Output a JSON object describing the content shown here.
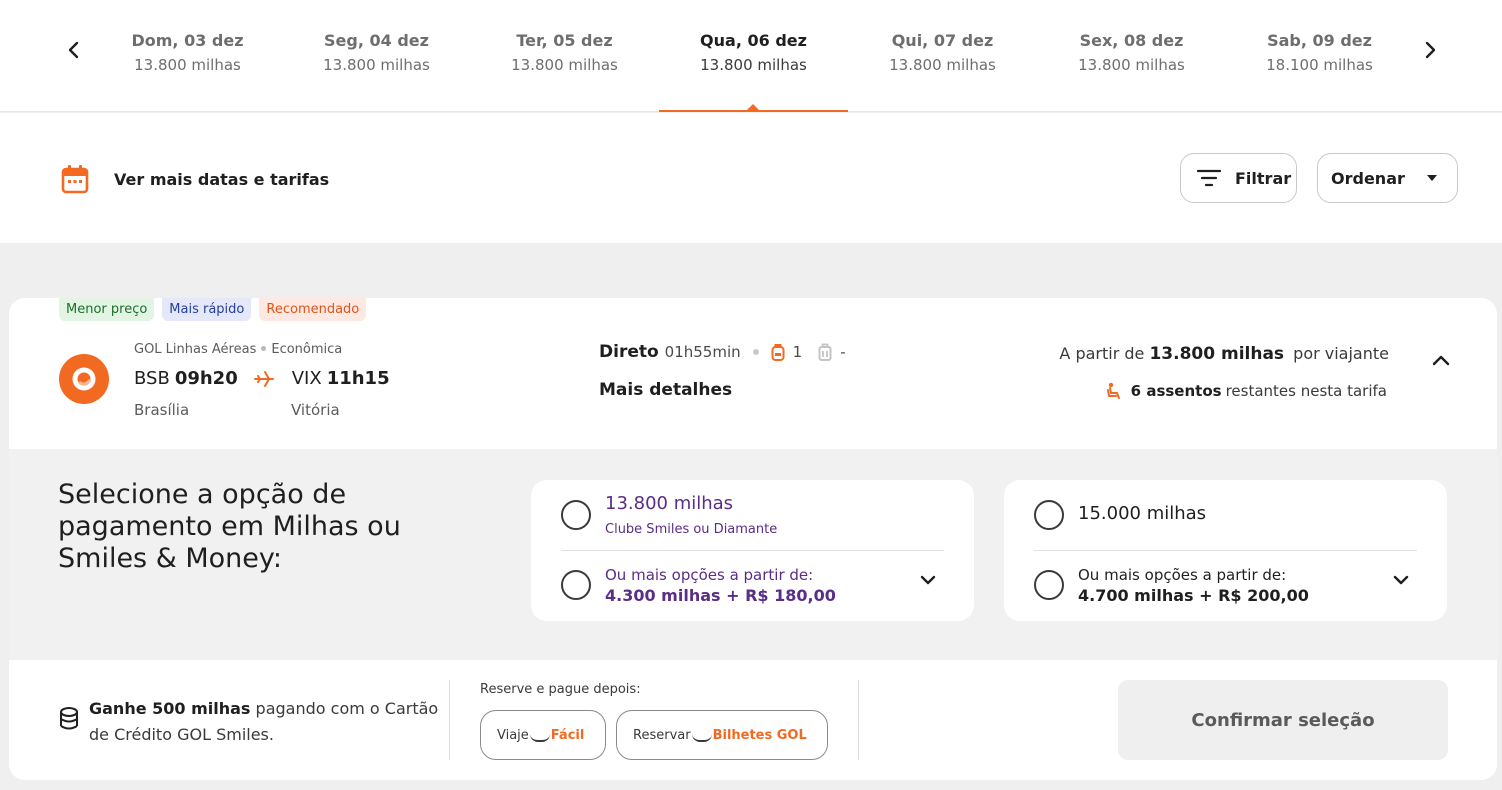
{
  "dates": [
    {
      "day": "Dom, 03 dez",
      "price": "13.800 milhas",
      "active": false
    },
    {
      "day": "Seg, 04 dez",
      "price": "13.800 milhas",
      "active": false
    },
    {
      "day": "Ter, 05 dez",
      "price": "13.800 milhas",
      "active": false
    },
    {
      "day": "Qua, 06 dez",
      "price": "13.800 milhas",
      "active": true
    },
    {
      "day": "Qui, 07 dez",
      "price": "13.800 milhas",
      "active": false
    },
    {
      "day": "Sex, 08 dez",
      "price": "13.800 milhas",
      "active": false
    },
    {
      "day": "Sab, 09 dez",
      "price": "18.100 milhas",
      "active": false
    }
  ],
  "toolbar": {
    "more_dates_label": "Ver mais datas e tarifas",
    "filter_label": "Filtrar",
    "order_label": "Ordenar"
  },
  "colors": {
    "accent": "#f26a21",
    "purple": "#5a2d86"
  },
  "flight": {
    "badges": [
      "Menor preço",
      "Mais rápido",
      "Recomendado"
    ],
    "airline": "GOL Linhas Aéreas",
    "cabin": "Econômica",
    "origin_code": "BSB",
    "departure": "09h20",
    "origin_city": "Brasília",
    "dest_code": "VIX",
    "arrival": "11h15",
    "dest_city": "Vitória",
    "stops": "Direto",
    "duration": "01h55min",
    "carry_on_count": "1",
    "checked_bag": "-",
    "details_label": "Mais detalhes",
    "price_prefix": "A partir de",
    "price": "13.800 milhas",
    "price_suffix": "por viajante",
    "seats": "6 assentos",
    "seats_suffix": "restantes nesta tarifa"
  },
  "payment": {
    "title": "Selecione a opção de pagamento em Milhas ou Smiles & Money:",
    "options": [
      {
        "main": "13.800 milhas",
        "sub": "Clube Smiles ou Diamante",
        "more_label": "Ou mais opções a partir de:",
        "more_value": "4.300 milhas + R$ 180,00"
      },
      {
        "main": "15.000 milhas",
        "sub": "",
        "more_label": "Ou mais opções a partir de:",
        "more_value": "4.700 milhas + R$ 200,00"
      }
    ]
  },
  "footer": {
    "earn_bold": "Ganhe 500 milhas",
    "earn_rest": "pagando com o Cartão de Crédito GOL Smiles.",
    "reserve_label": "Reserve e pague depois:",
    "viaje_prefix": "Viaje",
    "viaje_highlight": "Fácil",
    "reservar_prefix": "Reservar",
    "reservar_highlight": "Bilhetes GOL",
    "confirm_label": "Confirmar seleção"
  }
}
